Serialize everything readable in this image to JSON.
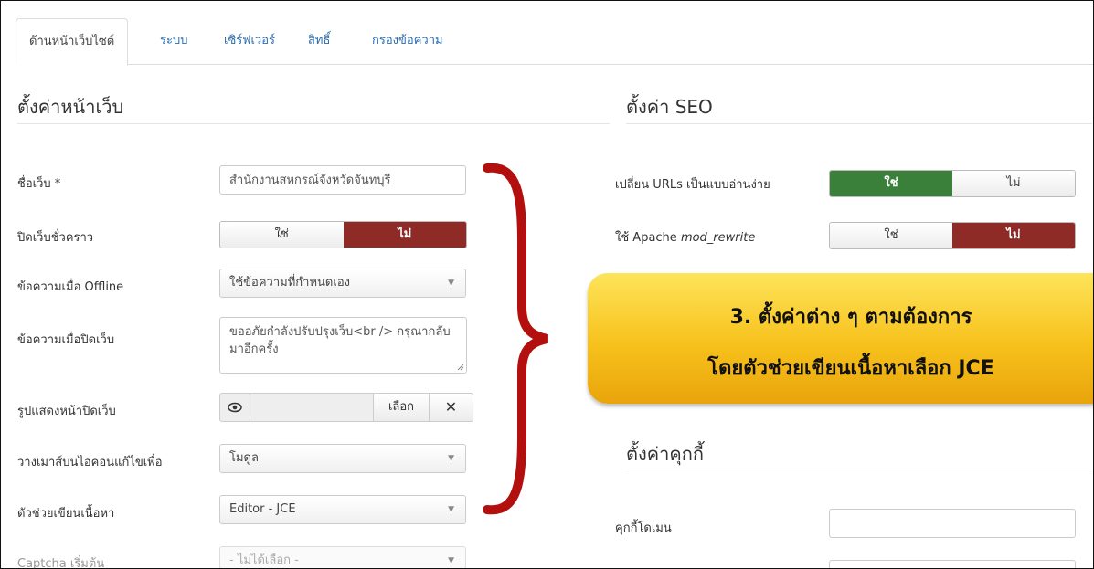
{
  "tabs": [
    "ด้านหน้าเว็บไซต์",
    "ระบบ",
    "เซิร์ฟเวอร์",
    "สิทธิ์",
    "กรองข้อความ"
  ],
  "site_settings": {
    "title": "ตั้งค่าหน้าเว็บ",
    "site_name_label": "ชื่อเว็บ *",
    "site_name_value": "สำนักงานสหกรณ์จังหวัดจันทบุรี",
    "offline_label": "ปิดเว็บชั่วคราว",
    "offline_yes": "ใช่",
    "offline_no": "ไม่",
    "offline_message_label": "ข้อความเมื่อ Offline",
    "offline_message_value": "ใช้ข้อความที่กำหนดเอง",
    "custom_message_label": "ข้อความเมื่อปิดเว็บ",
    "custom_message_value": "ขออภัยกำลังปรับปรุงเว็บ<br /> กรุณากลับมาอีกครั้ง",
    "offline_image_label": "รูปแสดงหน้าปิดเว็บ",
    "select_button": "เลือก",
    "mouseover_label": "วางเมาส์บนไอคอนแก้ไขเพื่อ",
    "mouseover_value": "โมดูล",
    "editor_label": "ตัวช่วยเขียนเนื้อหา",
    "editor_value": "Editor - JCE",
    "captcha_label": "Captcha เริ่มต้น",
    "captcha_value": "- ไม่ได้เลือก -"
  },
  "seo_settings": {
    "title": "ตั้งค่า SEO",
    "sef_label": "เปลี่ยน URLs เป็นแบบอ่านง่าย",
    "sef_yes": "ใช่",
    "sef_no": "ไม่",
    "rewrite_label_prefix": "ใช้ Apache ",
    "rewrite_label_code": "mod_rewrite",
    "rewrite_yes": "ใช่",
    "rewrite_no": "ไม่"
  },
  "callout": {
    "line1": "3. ตั้งค่าต่าง ๆ ตามต้องการ",
    "line2": "โดยตัวช่วยเขียนเนื้อหาเลือก JCE"
  },
  "cookie_settings": {
    "title": "ตั้งค่าคุกกี้",
    "domain_label": "คุกกี้โดเมน"
  },
  "colors": {
    "active_yes": "#3a7f3a",
    "active_no": "#8e2b26",
    "brace": "#b30f0f",
    "callout": "#f7c11c",
    "link": "#2a6db1"
  },
  "icons": {
    "preview": "eye-icon",
    "clear": "close-icon",
    "dropdown": "caret-down-icon"
  }
}
